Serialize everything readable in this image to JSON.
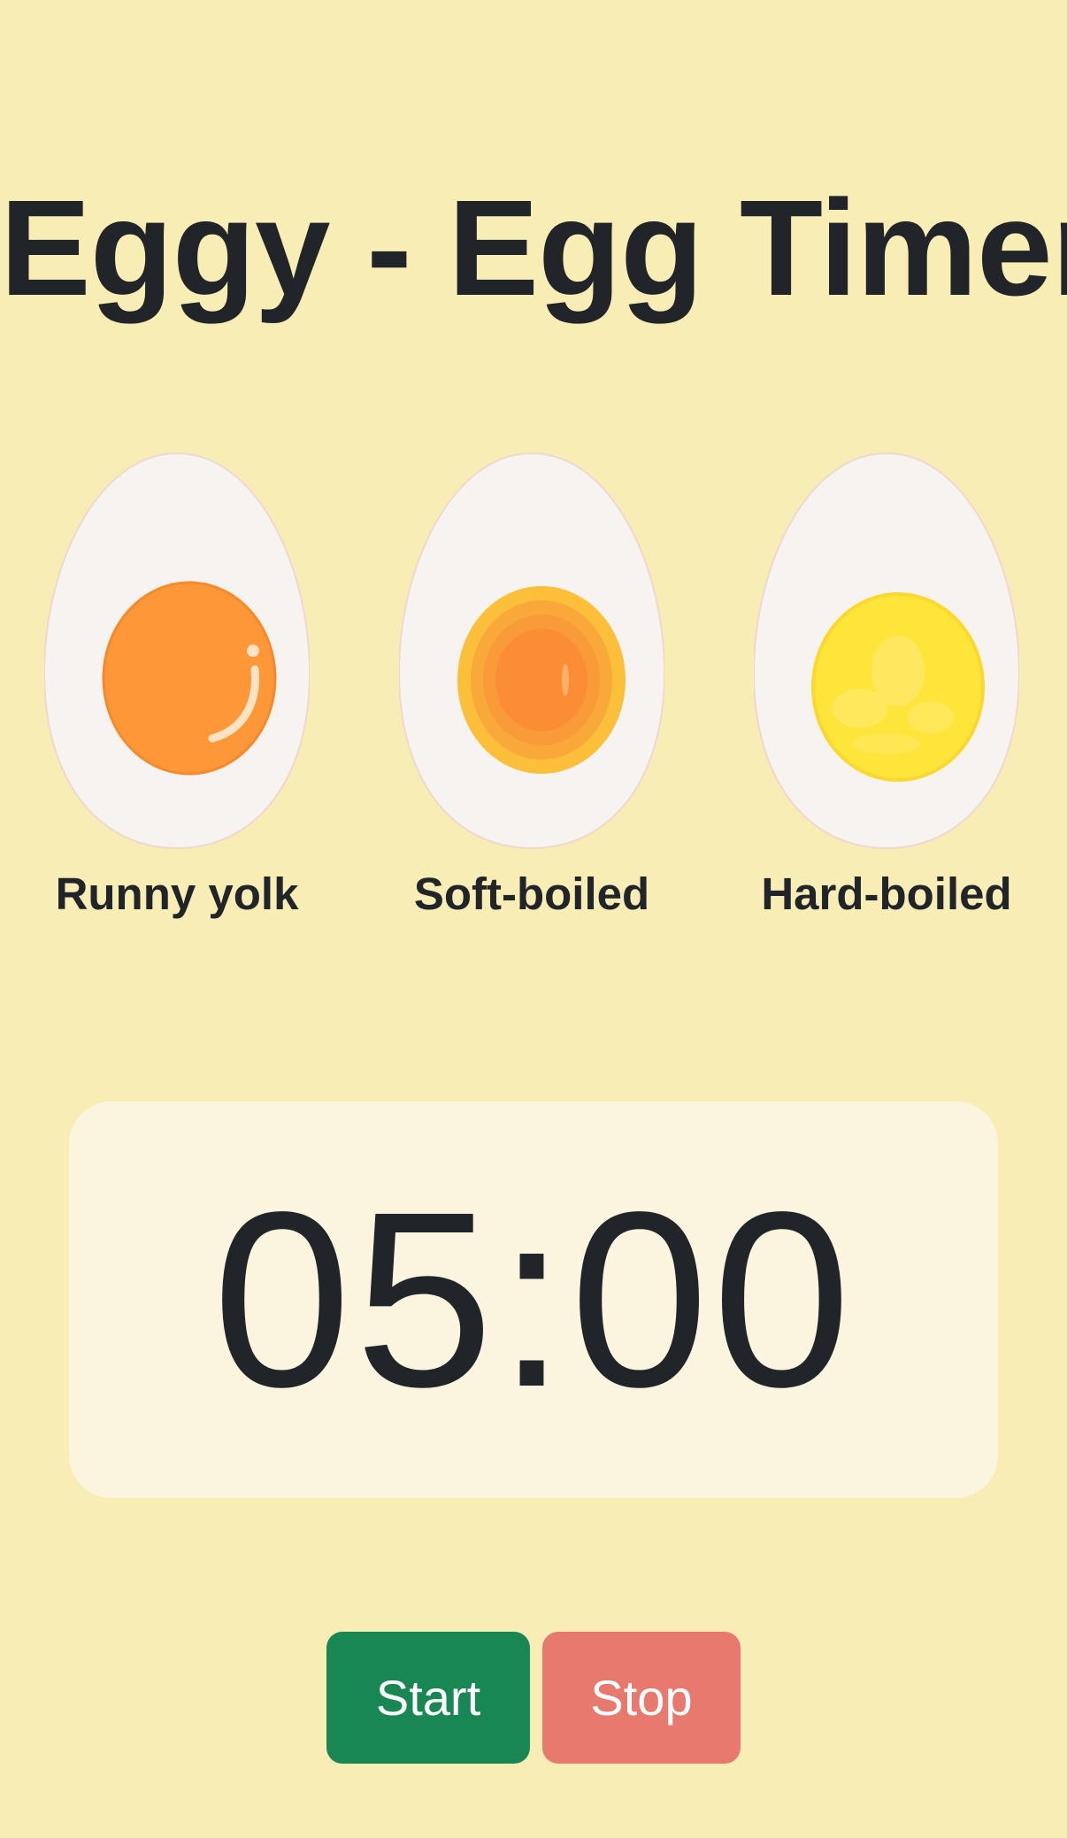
{
  "page": {
    "title": "Eggy - Egg Timer",
    "background_color": "#f9edb6"
  },
  "eggs": [
    {
      "label": "Runny yolk",
      "yolk_color": "#fd9738",
      "icon": "runny-egg-icon"
    },
    {
      "label": "Soft-boiled",
      "yolk_color": "#fbbf3a",
      "icon": "soft-boiled-egg-icon"
    },
    {
      "label": "Hard-boiled",
      "yolk_color": "#ffe53a",
      "icon": "hard-boiled-egg-icon"
    }
  ],
  "timer": {
    "display": "05:00"
  },
  "controls": {
    "start_label": "Start",
    "start_color": "#198754",
    "stop_label": "Stop",
    "stop_color": "#e7796e"
  }
}
